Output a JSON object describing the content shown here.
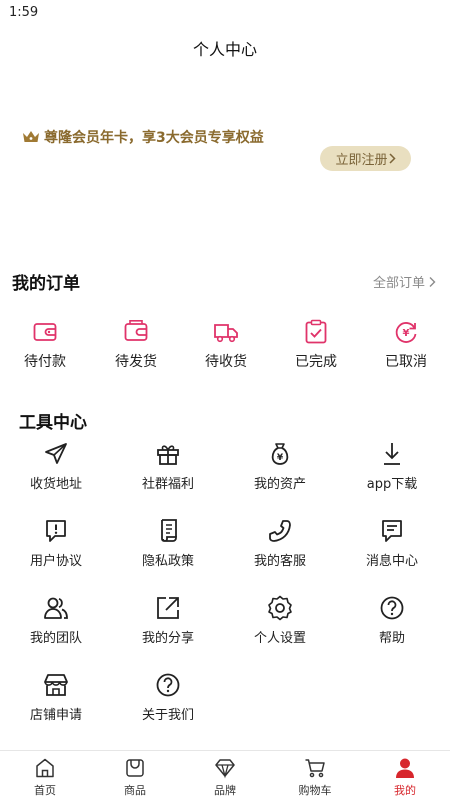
{
  "status": {
    "time": "1:59"
  },
  "page": {
    "title": "个人中心"
  },
  "vip": {
    "text": "尊隆会员年卡，享3大会员专享权益",
    "button": "立即注册",
    "icon": "crown-icon",
    "color": "#8a6a2e",
    "button_bg": "#e9dfc0"
  },
  "orders": {
    "title": "我的订单",
    "all_label": "全部订单",
    "accent": "#e0336a",
    "items": [
      {
        "label": "待付款",
        "icon": "wallet-icon"
      },
      {
        "label": "待发货",
        "icon": "package-icon"
      },
      {
        "label": "待收货",
        "icon": "truck-icon"
      },
      {
        "label": "已完成",
        "icon": "clipboard-check-icon"
      },
      {
        "label": "已取消",
        "icon": "refund-icon"
      }
    ]
  },
  "tools": {
    "title": "工具中心",
    "items": [
      {
        "label": "收货地址",
        "icon": "send-icon"
      },
      {
        "label": "社群福利",
        "icon": "gift-icon"
      },
      {
        "label": "我的资产",
        "icon": "money-bag-icon"
      },
      {
        "label": "app下载",
        "icon": "download-icon"
      },
      {
        "label": "用户协议",
        "icon": "alert-message-icon"
      },
      {
        "label": "隐私政策",
        "icon": "document-icon"
      },
      {
        "label": "我的客服",
        "icon": "phone-icon"
      },
      {
        "label": "消息中心",
        "icon": "message-icon"
      },
      {
        "label": "我的团队",
        "icon": "team-icon"
      },
      {
        "label": "我的分享",
        "icon": "share-icon"
      },
      {
        "label": "个人设置",
        "icon": "settings-icon"
      },
      {
        "label": "帮助",
        "icon": "help-icon"
      },
      {
        "label": "店铺申请",
        "icon": "store-icon"
      },
      {
        "label": "关于我们",
        "icon": "question-icon"
      }
    ]
  },
  "tabbar": {
    "active_color": "#d7262c",
    "items": [
      {
        "label": "首页",
        "icon": "home-icon"
      },
      {
        "label": "商品",
        "icon": "product-icon"
      },
      {
        "label": "品牌",
        "icon": "diamond-icon"
      },
      {
        "label": "购物车",
        "icon": "cart-icon"
      },
      {
        "label": "我的",
        "icon": "user-icon",
        "active": true
      }
    ]
  }
}
